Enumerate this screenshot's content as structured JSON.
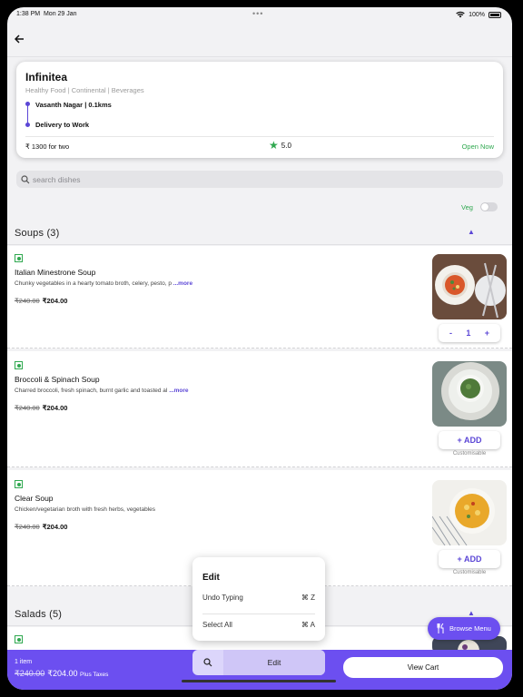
{
  "status_bar": {
    "time": "1:38 PM",
    "date": "Mon 29 Jan",
    "battery": "100%"
  },
  "restaurant": {
    "name": "Infinitea",
    "cuisines": "Healthy Food | Continental | Beverages",
    "location": "Vasanth Nagar | 0.1kms",
    "delivery": "Delivery to Work",
    "cost": "₹ 1300 for two",
    "rating": "5.0",
    "status": "Open Now"
  },
  "search": {
    "placeholder": "search dishes"
  },
  "filter": {
    "veg_label": "Veg",
    "veg_on": false
  },
  "sections": {
    "soups": {
      "title": "Soups (3)"
    },
    "salads": {
      "title": "Salads (5)"
    }
  },
  "items": [
    {
      "name": "Italian Minestrone Soup",
      "desc": "Chunky vegetables in a hearty tomato broth, celery, pesto, p ",
      "more": "...more",
      "old_price": "₹240.00",
      "price": "₹204.00",
      "quantity": "1",
      "minus": "-",
      "plus": "+"
    },
    {
      "name": "Broccoli & Spinach Soup",
      "desc": "Charred broccoli, fresh spinach, burnt garlic and toasted al ",
      "more": "...more",
      "old_price": "₹240.00",
      "price": "₹204.00",
      "add_label": "+ ADD",
      "custom": "Customisable"
    },
    {
      "name": "Clear Soup",
      "desc": "Chicken/vegetarian broth with fresh herbs, vegetables",
      "old_price": "₹240.00",
      "price": "₹204.00",
      "add_label": "+ ADD",
      "custom": "Customisable"
    }
  ],
  "edit_menu": {
    "title": "Edit",
    "undo": "Undo Typing",
    "undo_shortcut": "⌘ Z",
    "select_all": "Select All",
    "select_all_shortcut": "⌘ A"
  },
  "browse_menu": {
    "label": "Browse Menu"
  },
  "cart": {
    "count": "1 item",
    "old_total": "₹240.00",
    "total": "₹204.00",
    "taxes": "Plus Taxes",
    "edit_label": "Edit",
    "view_cart": "View Cart"
  },
  "colors": {
    "accent": "#6c4ff0",
    "veg_green": "#2fa84f"
  }
}
